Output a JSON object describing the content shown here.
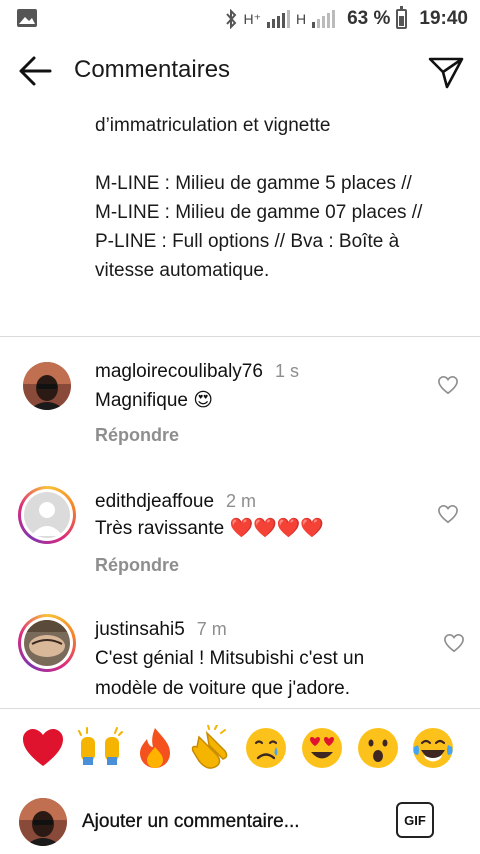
{
  "status_bar": {
    "network_1": "H⁺",
    "network_2": "H",
    "battery": "63 %",
    "time": "19:40"
  },
  "header": {
    "title": "Commentaires",
    "back_icon": "arrow-left-icon",
    "send_icon": "paper-plane-icon"
  },
  "caption": {
    "text": "d’immatriculation et vignette\n\nM-LINE : Milieu de gamme 5 places // M-LINE : Milieu de gamme 07 places // P-LINE : Full options // Bva : Boîte à vitesse automatique."
  },
  "comments": [
    {
      "username": "magloirecoulibaly76",
      "time": "1 s",
      "text": "Magnifique 😍",
      "reply": "Répondre"
    },
    {
      "username": "edithdjeaffoue",
      "time": "2 m",
      "text": "Très ravissante ❤️❤️❤️❤️",
      "reply": "Répondre"
    },
    {
      "username": "justinsahi5",
      "time": "7 m",
      "text": "C'est génial ! Mitsubishi c'est un modèle de voiture que j'adore."
    }
  ],
  "emoji_bar": [
    "❤️",
    "🙌",
    "🔥",
    "👏",
    "😢",
    "😍",
    "😮",
    "😂"
  ],
  "compose": {
    "placeholder": "Ajouter un commentaire...",
    "gif_label": "GIF"
  },
  "colors": {
    "text": "#111111",
    "muted": "#8e8e8e",
    "divider": "#dbdbdb"
  }
}
